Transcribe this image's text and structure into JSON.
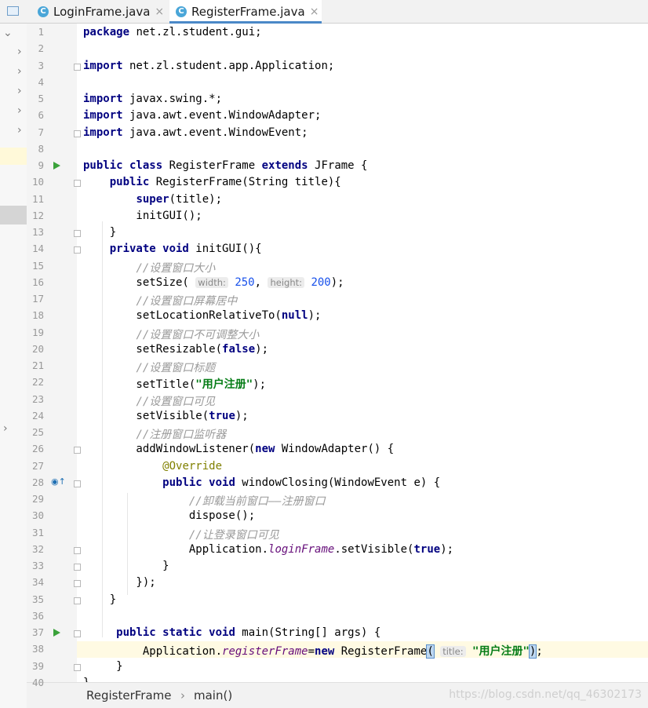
{
  "tabs": [
    {
      "icon": "java-class-icon",
      "letter": "C",
      "label": "LoginFrame.java",
      "close": "×",
      "active": false
    },
    {
      "icon": "java-class-icon",
      "letter": "C",
      "label": "RegisterFrame.java",
      "close": "×",
      "active": true
    }
  ],
  "current_line": 38,
  "code_lines": [
    {
      "n": "1",
      "html": "<span class=\"kw\">package</span> net.zl.student.gui;"
    },
    {
      "n": "2",
      "html": ""
    },
    {
      "n": "3",
      "html": "<span class=\"kw\">import</span> net.zl.student.app.Application;",
      "fold": true
    },
    {
      "n": "4",
      "html": ""
    },
    {
      "n": "5",
      "html": "<span class=\"kw\">import</span> javax.swing.*;"
    },
    {
      "n": "6",
      "html": "<span class=\"kw\">import</span> java.awt.event.WindowAdapter;"
    },
    {
      "n": "7",
      "html": "<span class=\"kw\">import</span> java.awt.event.WindowEvent;",
      "fold": true
    },
    {
      "n": "8",
      "html": ""
    },
    {
      "n": "9",
      "html": "<span class=\"kw\">public class</span> RegisterFrame <span class=\"kw\">extends</span> JFrame {",
      "run": true
    },
    {
      "n": "10",
      "html": "    <span class=\"kw\">public</span> RegisterFrame(String title){",
      "fold": true
    },
    {
      "n": "11",
      "html": "        <span class=\"kw\">super</span>(title);"
    },
    {
      "n": "12",
      "html": "        initGUI();"
    },
    {
      "n": "13",
      "html": "    }",
      "fold": true
    },
    {
      "n": "14",
      "html": "    <span class=\"kw\">private void</span> initGUI(){",
      "fold": true
    },
    {
      "n": "15",
      "html": "        <span class=\"cm\">//设置窗口大小</span>"
    },
    {
      "n": "16",
      "html": "        setSize( <span class=\"hint\">width:</span> <span style=\"color:#1750eb\">250</span>, <span class=\"hint\">height:</span> <span style=\"color:#1750eb\">200</span>);"
    },
    {
      "n": "17",
      "html": "        <span class=\"cm\">//设置窗口屏幕居中</span>"
    },
    {
      "n": "18",
      "html": "        setLocationRelativeTo(<span class=\"kw\">null</span>);"
    },
    {
      "n": "19",
      "html": "        <span class=\"cm\">//设置窗口不可调整大小</span>"
    },
    {
      "n": "20",
      "html": "        setResizable(<span class=\"kw\">false</span>);"
    },
    {
      "n": "21",
      "html": "        <span class=\"cm\">//设置窗口标题</span>"
    },
    {
      "n": "22",
      "html": "        setTitle(<span class=\"st\">\"用户注册\"</span>);"
    },
    {
      "n": "23",
      "html": "        <span class=\"cm\">//设置窗口可见</span>"
    },
    {
      "n": "24",
      "html": "        setVisible(<span class=\"kw\">true</span>);"
    },
    {
      "n": "25",
      "html": "        <span class=\"cm\">//注册窗口监听器</span>"
    },
    {
      "n": "26",
      "html": "        addWindowListener(<span class=\"kw\">new</span> WindowAdapter() {",
      "fold": true
    },
    {
      "n": "27",
      "html": "            <span class=\"an\">@Override</span>"
    },
    {
      "n": "28",
      "html": "            <span class=\"kw\">public void</span> windowClosing(WindowEvent e) {",
      "fold": true,
      "override": true
    },
    {
      "n": "29",
      "html": "                <span class=\"cm\">//卸载当前窗口——注册窗口</span>"
    },
    {
      "n": "30",
      "html": "                dispose();"
    },
    {
      "n": "31",
      "html": "                <span class=\"cm\">//让登录窗口可见</span>"
    },
    {
      "n": "32",
      "html": "                Application.<span class=\"fi\">loginFrame</span>.setVisible(<span class=\"kw\">true</span>);",
      "fold": true
    },
    {
      "n": "33",
      "html": "            }",
      "fold": true
    },
    {
      "n": "34",
      "html": "        });",
      "fold": true
    },
    {
      "n": "35",
      "html": "    }",
      "fold": true
    },
    {
      "n": "36",
      "html": ""
    },
    {
      "n": "37",
      "html": "     <span class=\"kw\">public static void</span> main(String[] args) {",
      "run": true,
      "fold": true
    },
    {
      "n": "38",
      "html": "         Application.<span class=\"fi\">registerFrame</span>=<span class=\"kw\">new</span> RegisterFrame<span class=\"br\">(</span> <span class=\"hint\">title:</span> <span class=\"st\">\"用户注册\"</span><span class=\"br\">)</span>;"
    },
    {
      "n": "39",
      "html": "     }",
      "fold": true
    },
    {
      "n": "40",
      "html": "}"
    }
  ],
  "breadcrumb": {
    "item1": "RegisterFrame",
    "separator": "›",
    "item2": "main()"
  },
  "watermark": "https://blog.csdn.net/qq_46302173",
  "colors": {
    "keyword": "#000080",
    "comment": "#9a9a9a",
    "string": "#067d17",
    "annotation": "#808000",
    "field": "#660e7a",
    "accent": "#4a88c7"
  }
}
